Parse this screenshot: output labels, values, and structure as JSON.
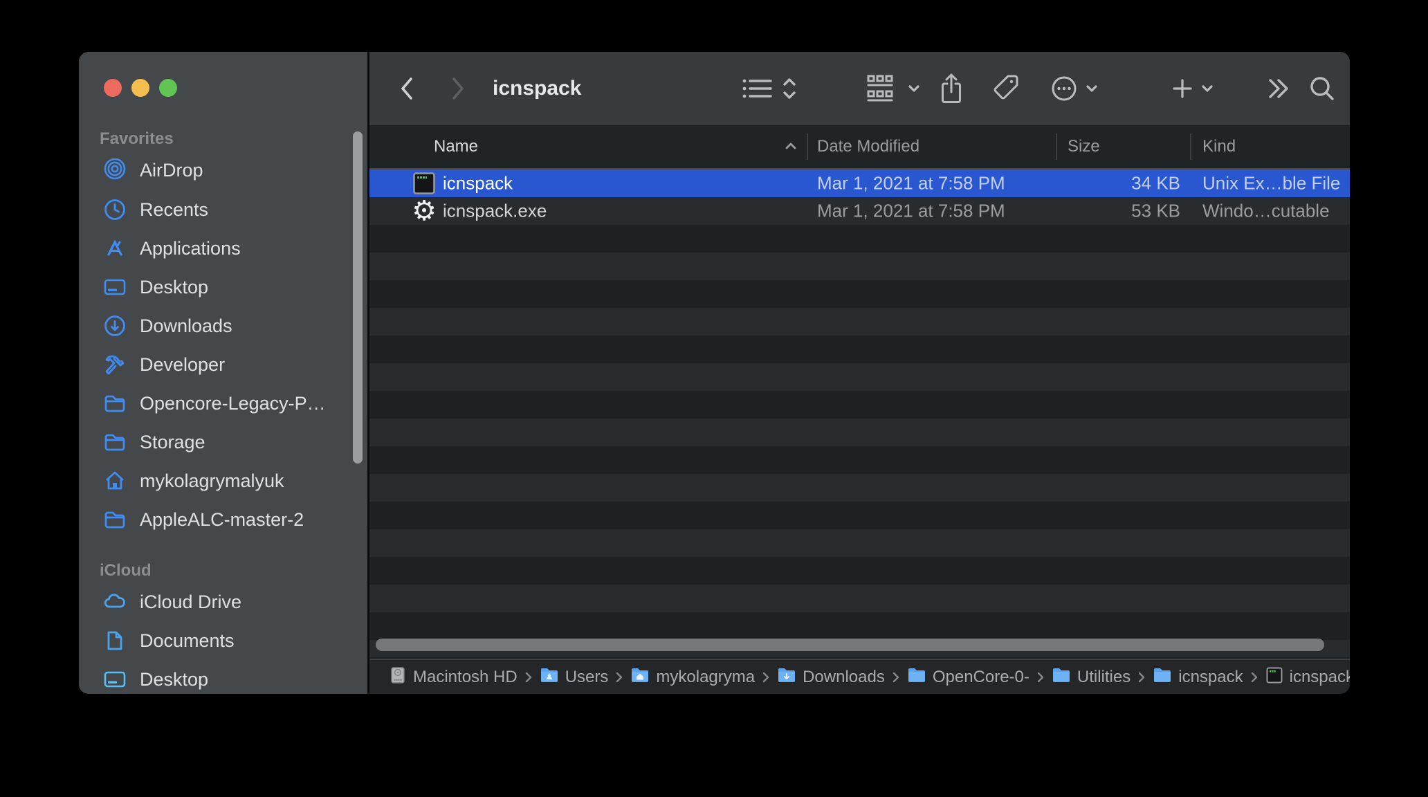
{
  "colors": {
    "selection_blue": "#2857d0",
    "sidebar_icon_blue": "#3f8cf3",
    "icloud_icon_blue": "#4aa3ef",
    "icloud_desktop_cyan": "#55c0f3",
    "traffic_red": "#ed6a5e",
    "traffic_yellow": "#f5bf4f",
    "traffic_green": "#61c554"
  },
  "window": {
    "title": "icnspack"
  },
  "sidebar": {
    "sections": [
      {
        "label": "Favorites",
        "items": [
          {
            "icon": "airdrop-icon",
            "label": "AirDrop"
          },
          {
            "icon": "clock-icon",
            "label": "Recents"
          },
          {
            "icon": "applications-icon",
            "label": "Applications"
          },
          {
            "icon": "desktop-icon",
            "label": "Desktop"
          },
          {
            "icon": "downloads-icon",
            "label": "Downloads"
          },
          {
            "icon": "hammer-icon",
            "label": "Developer"
          },
          {
            "icon": "folder-icon",
            "label": "Opencore-Legacy-P…"
          },
          {
            "icon": "folder-icon",
            "label": "Storage"
          },
          {
            "icon": "home-icon",
            "label": "mykolagrymalyuk"
          },
          {
            "icon": "folder-icon",
            "label": "AppleALC-master-2"
          }
        ]
      },
      {
        "label": "iCloud",
        "items": [
          {
            "icon": "cloud-icon",
            "label": "iCloud Drive"
          },
          {
            "icon": "document-icon",
            "label": "Documents"
          },
          {
            "icon": "desktop-icon",
            "label": "Desktop"
          }
        ]
      }
    ]
  },
  "table": {
    "columns": [
      "Name",
      "Date Modified",
      "Size",
      "Kind"
    ],
    "sort_column": "Name",
    "rows": [
      {
        "name": "icnspack",
        "icon": "unix-executable-icon",
        "date": "Mar 1, 2021 at 7:58 PM",
        "size": "34 KB",
        "kind": "Unix Ex…ble File",
        "selected": true
      },
      {
        "name": "icnspack.exe",
        "icon": "windows-executable-icon",
        "date": "Mar 1, 2021 at 7:58 PM",
        "size": "53 KB",
        "kind": "Windo…cutable",
        "selected": false
      }
    ]
  },
  "pathbar": {
    "items": [
      {
        "icon": "hard-drive-icon",
        "label": "Macintosh HD"
      },
      {
        "icon": "folder-users-icon",
        "label": "Users"
      },
      {
        "icon": "folder-home-icon",
        "label": "mykolagryma"
      },
      {
        "icon": "folder-downloads-icon",
        "label": "Downloads"
      },
      {
        "icon": "folder-icon",
        "label": "OpenCore-0-"
      },
      {
        "icon": "folder-icon",
        "label": "Utilities"
      },
      {
        "icon": "folder-icon",
        "label": "icnspack"
      },
      {
        "icon": "unix-executable-icon",
        "label": "icnspack"
      }
    ]
  }
}
